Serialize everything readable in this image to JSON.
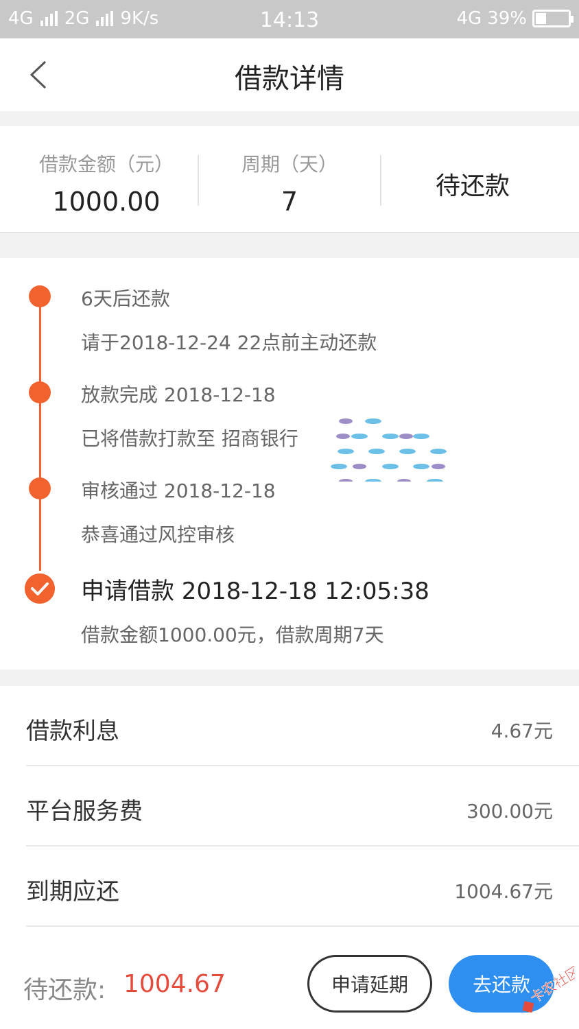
{
  "status_bar": {
    "network_left": "4G",
    "network_left_2": "2G",
    "speed": "9K/s",
    "time": "14:13",
    "network_right": "4G",
    "battery": "39%"
  },
  "header": {
    "title": "借款详情",
    "back_icon": "chevron-left-icon"
  },
  "summary": {
    "amount_label": "借款金额（元）",
    "amount_value": "1000.00",
    "period_label": "周期（天）",
    "period_value": "7",
    "status": "待还款"
  },
  "timeline": {
    "steps": [
      {
        "title": "6天后还款",
        "detail": "请于2018-12-24 22点前主动还款"
      },
      {
        "title": "放款完成 2018-12-18",
        "detail": "已将借款打款至 招商银行"
      },
      {
        "title": "审核通过 2018-12-18",
        "detail": "恭喜通过风控审核"
      },
      {
        "title": "申请借款 2018-12-18 12:05:38",
        "detail": "借款金额1000.00元，借款周期7天"
      }
    ]
  },
  "fees": [
    {
      "label": "借款利息",
      "value": "4.67元"
    },
    {
      "label": "平台服务费",
      "value": "300.00元"
    },
    {
      "label": "到期应还",
      "value": "1004.67元"
    }
  ],
  "bottom": {
    "due_label": "待还款:",
    "due_amount": "1004.67",
    "extend_button": "申请延期",
    "repay_button": "去还款",
    "site_watermark": "卡农社区"
  },
  "colors": {
    "accent": "#f2622e",
    "primary_button": "#2e8ff0",
    "due_amount": "#e54b3c"
  }
}
